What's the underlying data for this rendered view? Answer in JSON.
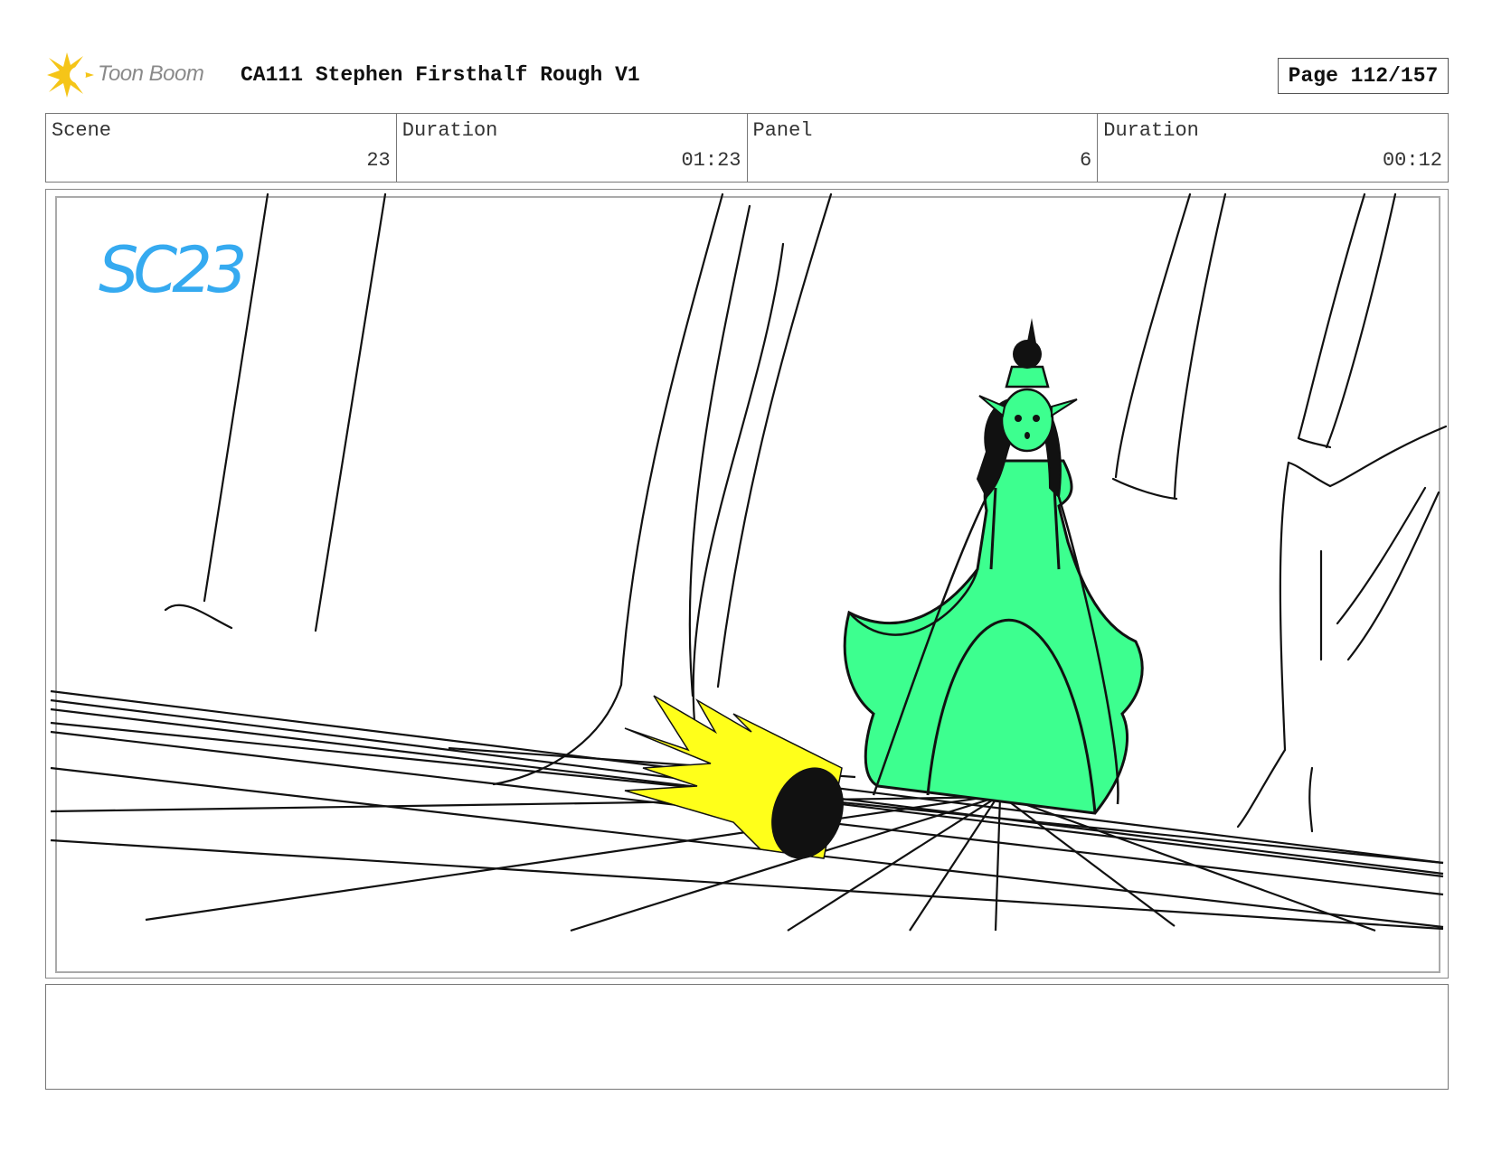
{
  "header": {
    "logo_text": "Toon Boom",
    "title": "CA111 Stephen Firsthalf Rough V1",
    "page_label": "Page 112/157"
  },
  "info": [
    {
      "label": "Scene",
      "value": "23"
    },
    {
      "label": "Duration",
      "value": "01:23"
    },
    {
      "label": "Panel",
      "value": "6"
    },
    {
      "label": "Duration",
      "value": "00:12"
    }
  ],
  "panel": {
    "scene_tag": "SC23"
  },
  "colors": {
    "scene_tag": "#35aaf0",
    "character_fill": "#3dff8f",
    "flame_fill": "#ffff1a",
    "logo": "#f5c518"
  }
}
